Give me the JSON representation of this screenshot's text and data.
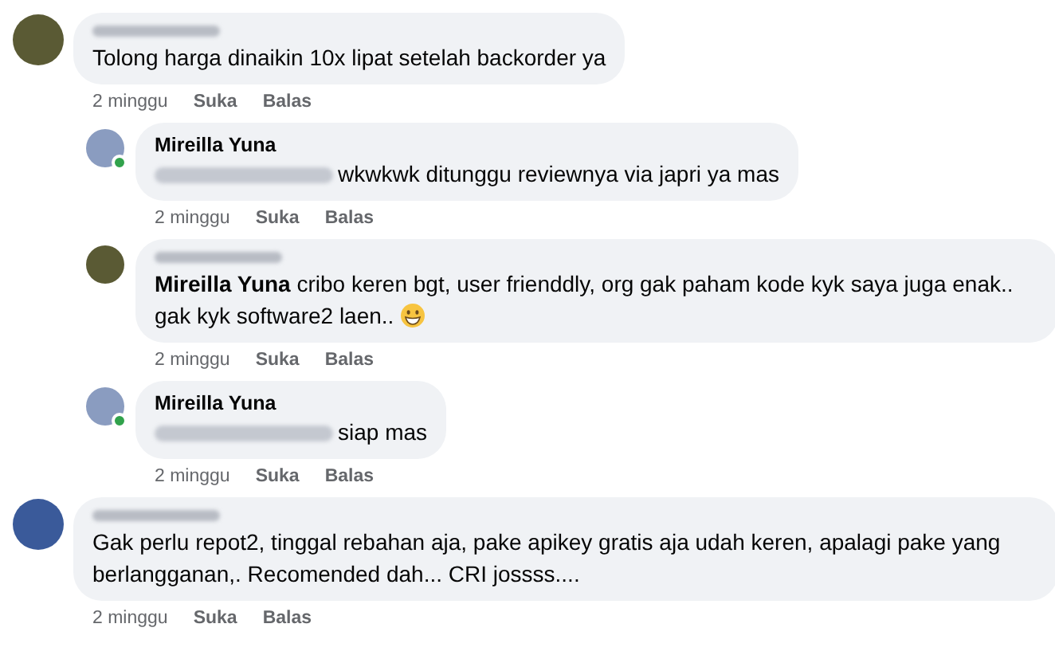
{
  "comments": [
    {
      "author_blurred": true,
      "color": "#5a5a34",
      "text": "Tolong harga dinaikin 10x lipat setelah backorder ya",
      "time": "2 minggu",
      "like": "Suka",
      "reply": "Balas",
      "replies": [
        {
          "author": "Mireilla Yuna",
          "color": "#8a9cc0",
          "online": true,
          "mention_blurred": true,
          "text": "wkwkwk ditunggu reviewnya via japri ya mas",
          "time": "2 minggu",
          "like": "Suka",
          "reply": "Balas"
        },
        {
          "author_blurred": true,
          "color": "#5a5a34",
          "mention": "Mireilla Yuna",
          "text": "cribo keren bgt, user frienddly, org gak paham kode kyk saya juga enak.. gak kyk software2 laen..",
          "emoji": true,
          "time": "2 minggu",
          "like": "Suka",
          "reply": "Balas"
        },
        {
          "author": "Mireilla Yuna",
          "color": "#8a9cc0",
          "online": true,
          "mention_blurred": true,
          "text": "siap mas",
          "time": "2 minggu",
          "like": "Suka",
          "reply": "Balas"
        }
      ]
    },
    {
      "author_blurred": true,
      "color": "#3a5a9a",
      "text": "Gak perlu repot2, tinggal rebahan aja, pake apikey gratis aja udah keren, apalagi pake yang berlangganan,. Recomended dah... CRI jossss....",
      "time": "2 minggu",
      "like": "Suka",
      "reply": "Balas"
    }
  ]
}
